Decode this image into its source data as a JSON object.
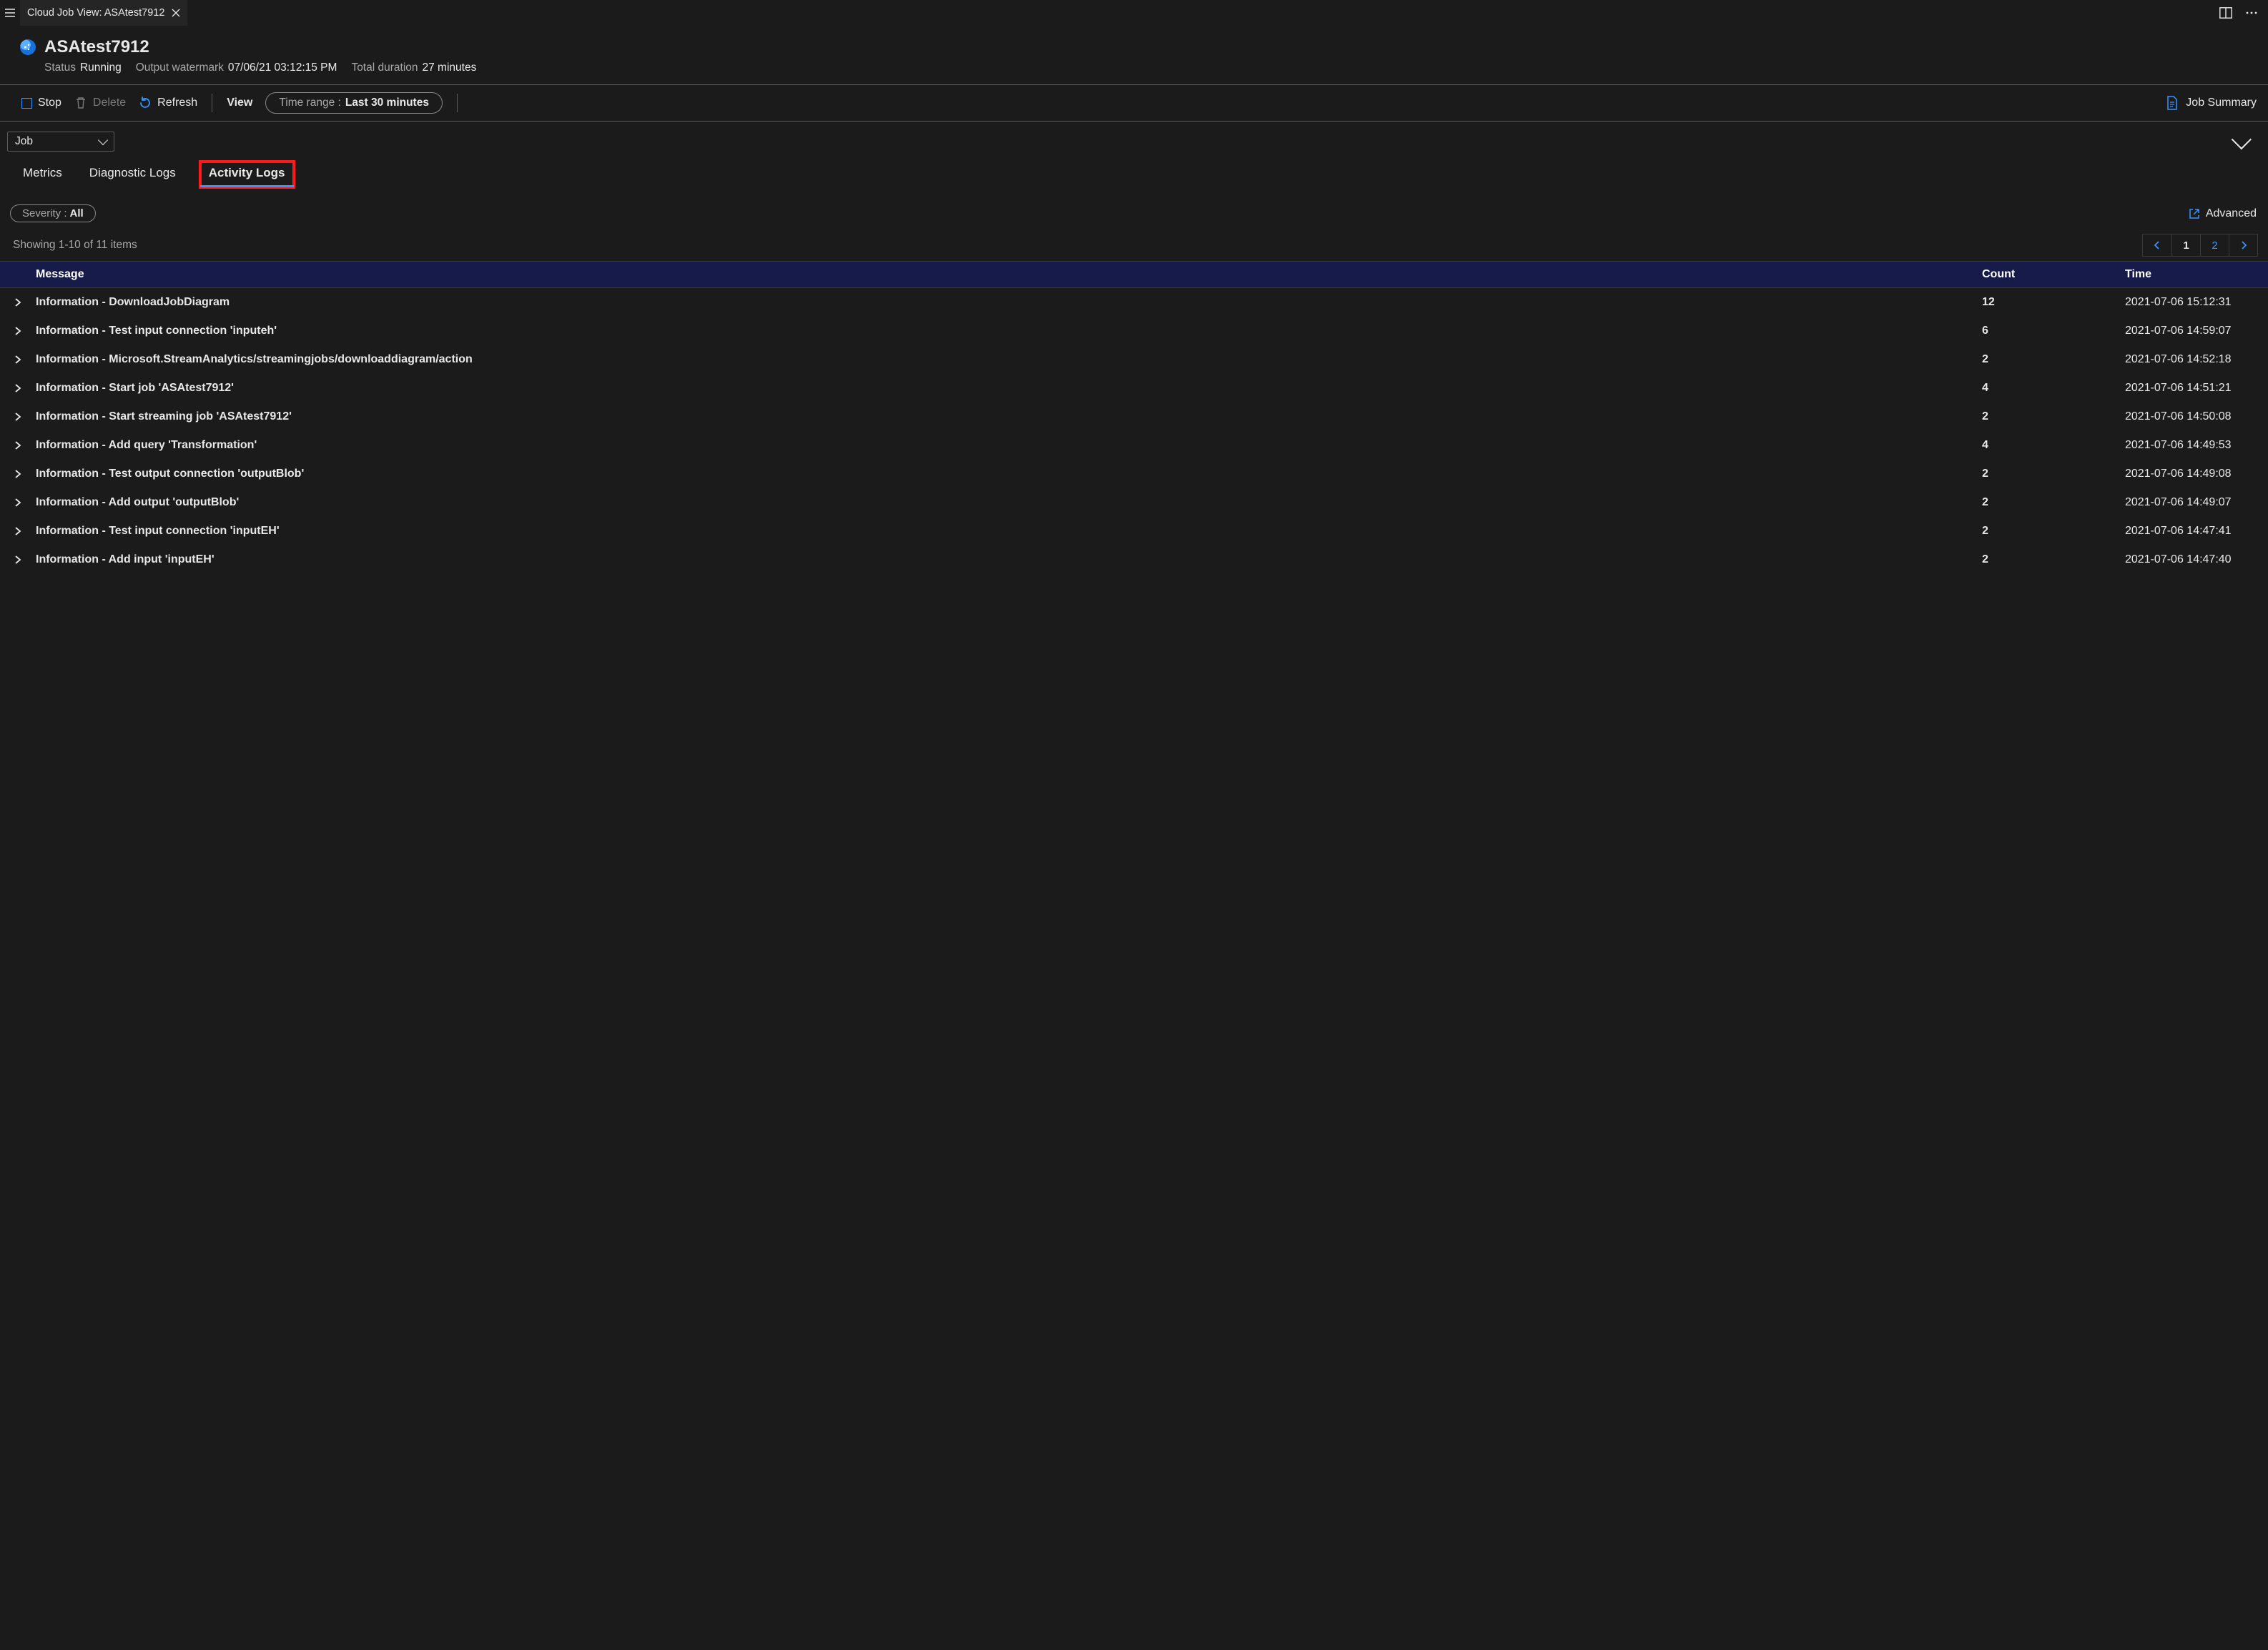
{
  "tabstrip": {
    "file_tab_title": "Cloud Job View: ASAtest7912"
  },
  "header": {
    "job_name": "ASAtest7912",
    "status_label": "Status",
    "status_value": "Running",
    "watermark_label": "Output watermark",
    "watermark_value": "07/06/21 03:12:15 PM",
    "duration_label": "Total duration",
    "duration_value": "27 minutes"
  },
  "toolbar": {
    "stop": "Stop",
    "delete": "Delete",
    "refresh": "Refresh",
    "view": "View",
    "time_range_label": "Time range :",
    "time_range_value": "Last 30 minutes",
    "job_summary": "Job Summary"
  },
  "dropdown": {
    "selected": "Job"
  },
  "tabs": {
    "metrics": "Metrics",
    "diag_logs": "Diagnostic Logs",
    "act_logs": "Activity Logs"
  },
  "filter": {
    "label": "Severity :",
    "value": "All",
    "advanced": "Advanced"
  },
  "listing": {
    "showing": "Showing 1-10 of 11 items"
  },
  "pager": {
    "page1": "1",
    "page2": "2"
  },
  "columns": {
    "message": "Message",
    "count": "Count",
    "time": "Time"
  },
  "rows": [
    {
      "message": "Information - DownloadJobDiagram",
      "count": "12",
      "time": "2021-07-06 15:12:31"
    },
    {
      "message": "Information - Test input connection 'inputeh'",
      "count": "6",
      "time": "2021-07-06 14:59:07"
    },
    {
      "message": "Information - Microsoft.StreamAnalytics/streamingjobs/downloaddiagram/action",
      "count": "2",
      "time": "2021-07-06 14:52:18"
    },
    {
      "message": "Information - Start job 'ASAtest7912'",
      "count": "4",
      "time": "2021-07-06 14:51:21"
    },
    {
      "message": "Information - Start streaming job 'ASAtest7912'",
      "count": "2",
      "time": "2021-07-06 14:50:08"
    },
    {
      "message": "Information - Add query 'Transformation'",
      "count": "4",
      "time": "2021-07-06 14:49:53"
    },
    {
      "message": "Information - Test output connection 'outputBlob'",
      "count": "2",
      "time": "2021-07-06 14:49:08"
    },
    {
      "message": "Information - Add output 'outputBlob'",
      "count": "2",
      "time": "2021-07-06 14:49:07"
    },
    {
      "message": "Information - Test input connection 'inputEH'",
      "count": "2",
      "time": "2021-07-06 14:47:41"
    },
    {
      "message": "Information - Add input 'inputEH'",
      "count": "2",
      "time": "2021-07-06 14:47:40"
    }
  ]
}
